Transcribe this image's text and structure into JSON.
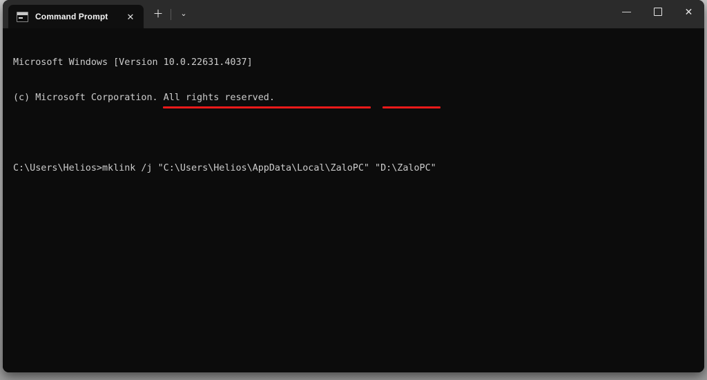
{
  "window": {
    "app_name": "Command Prompt",
    "tab": {
      "icon": "command-prompt-icon",
      "title": "Command Prompt",
      "close_glyph": "✕"
    },
    "new_tab_glyph": "＋",
    "tab_dropdown_glyph": "⌄",
    "controls": {
      "minimize_glyph": "—",
      "maximize_label": "maximize",
      "close_glyph": "✕"
    }
  },
  "terminal": {
    "background_color": "#0c0c0c",
    "foreground_color": "#cccccc",
    "lines": [
      "Microsoft Windows [Version 10.0.22631.4037]",
      "(c) Microsoft Corporation. All rights reserved.",
      "",
      "C:\\Users\\Helios>mklink /j \"C:\\Users\\Helios\\AppData\\Local\\ZaloPC\" \"D:\\ZaloPC\""
    ],
    "prompt": "C:\\Users\\Helios>",
    "command": "mklink /j \"C:\\Users\\Helios\\AppData\\Local\\ZaloPC\" \"D:\\ZaloPC\"",
    "os_version": "10.0.22631.4037"
  },
  "annotations": {
    "color": "#ef1a1a",
    "items": [
      {
        "name": "source-path-underline",
        "text": "\"C:\\Users\\Helios\\AppData\\Local\\ZaloPC\""
      },
      {
        "name": "target-path-underline",
        "text": "\"D:\\ZaloPC\""
      }
    ]
  }
}
